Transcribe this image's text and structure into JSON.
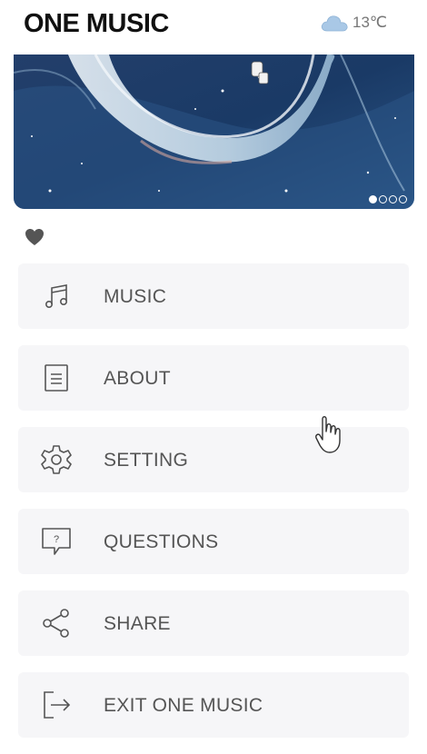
{
  "header": {
    "title": "ONE MUSIC",
    "weather": {
      "icon": "cloud-icon",
      "temperature": "13℃"
    }
  },
  "banner": {
    "image": "illustration-night-sky",
    "slides_total": 4,
    "active_slide": 1
  },
  "like": {
    "icon": "heart-icon",
    "color": "#555555"
  },
  "menu": {
    "items": [
      {
        "id": "music",
        "label": "MUSIC",
        "icon": "music-note-icon"
      },
      {
        "id": "about",
        "label": "ABOUT",
        "icon": "document-icon"
      },
      {
        "id": "setting",
        "label": "SETTING",
        "icon": "gear-icon"
      },
      {
        "id": "questions",
        "label": "QUESTIONS",
        "icon": "question-message-icon"
      },
      {
        "id": "share",
        "label": "SHARE",
        "icon": "share-icon"
      },
      {
        "id": "exit",
        "label": "EXIT ONE MUSIC",
        "icon": "exit-icon"
      }
    ]
  },
  "colors": {
    "title": "#111111",
    "menu_bg": "#f6f6f8",
    "menu_text": "#555555",
    "banner_bg": "#1d3a63"
  }
}
